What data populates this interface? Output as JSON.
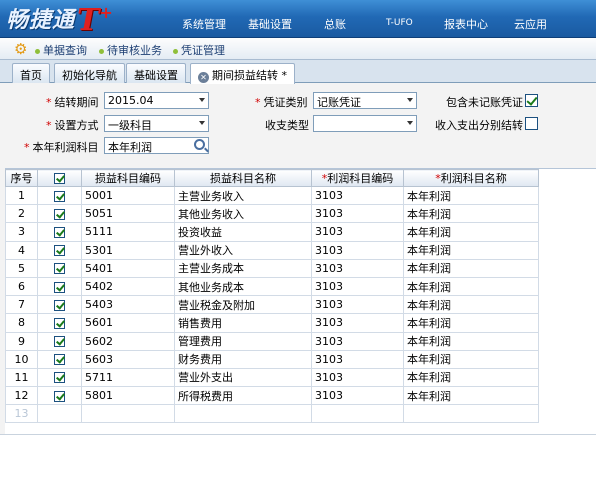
{
  "app": {
    "logo_text": "畅捷通",
    "logo_mark": "T",
    "logo_plus": "+"
  },
  "topnav": [
    {
      "label": "系统管理"
    },
    {
      "label": "基础设置"
    },
    {
      "label": "总账"
    },
    {
      "label": "T-UFO"
    },
    {
      "label": "报表中心"
    },
    {
      "label": "云应用"
    }
  ],
  "quickbar": [
    {
      "label": "单据查询"
    },
    {
      "label": "待审核业务"
    },
    {
      "label": "凭证管理"
    }
  ],
  "tabs": [
    {
      "label": "首页"
    },
    {
      "label": "初始化导航"
    },
    {
      "label": "基础设置"
    },
    {
      "label": "期间损益结转 *"
    }
  ],
  "form": {
    "period_label": "结转期间",
    "period_value": "2015.04",
    "voucher_type_label": "凭证类别",
    "voucher_type_value": "记账凭证",
    "include_unposted_label": "包含未记账凭证",
    "include_unposted_checked": true,
    "setting_mode_label": "设置方式",
    "setting_mode_value": "一级科目",
    "income_type_label": "收支类型",
    "income_type_value": "",
    "separate_label": "收入支出分别结转",
    "separate_checked": false,
    "profit_account_label": "本年利润科目",
    "profit_account_value": "本年利润"
  },
  "grid": {
    "headers": {
      "seq": "序号",
      "pl_code": "损益科目编码",
      "pl_name": "损益科目名称",
      "profit_code": "利润科目编码",
      "profit_name": "利润科目名称"
    },
    "rows": [
      {
        "seq": "1",
        "pl_code": "5001",
        "pl_name": "主营业务收入",
        "profit_code": "3103",
        "profit_name": "本年利润"
      },
      {
        "seq": "2",
        "pl_code": "5051",
        "pl_name": "其他业务收入",
        "profit_code": "3103",
        "profit_name": "本年利润"
      },
      {
        "seq": "3",
        "pl_code": "5111",
        "pl_name": "投资收益",
        "profit_code": "3103",
        "profit_name": "本年利润"
      },
      {
        "seq": "4",
        "pl_code": "5301",
        "pl_name": "营业外收入",
        "profit_code": "3103",
        "profit_name": "本年利润"
      },
      {
        "seq": "5",
        "pl_code": "5401",
        "pl_name": "主营业务成本",
        "profit_code": "3103",
        "profit_name": "本年利润"
      },
      {
        "seq": "6",
        "pl_code": "5402",
        "pl_name": "其他业务成本",
        "profit_code": "3103",
        "profit_name": "本年利润"
      },
      {
        "seq": "7",
        "pl_code": "5403",
        "pl_name": "营业税金及附加",
        "profit_code": "3103",
        "profit_name": "本年利润"
      },
      {
        "seq": "8",
        "pl_code": "5601",
        "pl_name": "销售费用",
        "profit_code": "3103",
        "profit_name": "本年利润"
      },
      {
        "seq": "9",
        "pl_code": "5602",
        "pl_name": "管理费用",
        "profit_code": "3103",
        "profit_name": "本年利润"
      },
      {
        "seq": "10",
        "pl_code": "5603",
        "pl_name": "财务费用",
        "profit_code": "3103",
        "profit_name": "本年利润"
      },
      {
        "seq": "11",
        "pl_code": "5711",
        "pl_name": "营业外支出",
        "profit_code": "3103",
        "profit_name": "本年利润"
      },
      {
        "seq": "12",
        "pl_code": "5801",
        "pl_name": "所得税费用",
        "profit_code": "3103",
        "profit_name": "本年利润"
      }
    ],
    "empty_row_seq": "13"
  }
}
